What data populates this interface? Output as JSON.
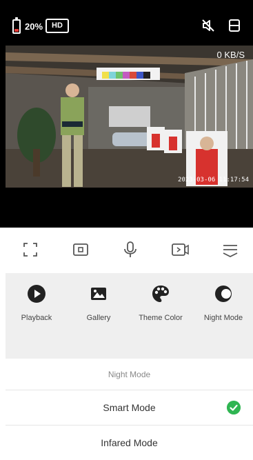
{
  "status": {
    "battery_percent": "20%",
    "quality_badge": "HD"
  },
  "video": {
    "speed": "0 KB/S",
    "timestamp": "2023-03-06 11:17:54"
  },
  "controls": {
    "items": [
      "fullscreen",
      "snapshot",
      "microphone",
      "record",
      "more"
    ]
  },
  "features": [
    {
      "label": "Playback"
    },
    {
      "label": "Gallery"
    },
    {
      "label": "Theme Color"
    },
    {
      "label": "Night Mode"
    }
  ],
  "night_mode_sheet": {
    "title": "Night Mode",
    "options": [
      {
        "label": "Smart Mode",
        "selected": true
      },
      {
        "label": "Infared Mode",
        "selected": false
      }
    ],
    "check_color": "#2fb552"
  }
}
